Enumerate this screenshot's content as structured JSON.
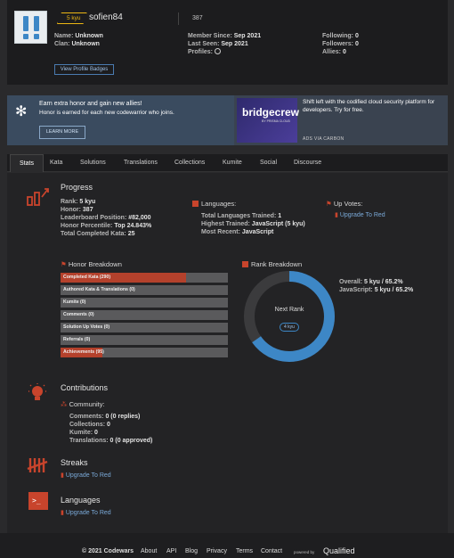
{
  "profile": {
    "rank_badge": "5 kyu",
    "username": "sofien84",
    "honor_score": "387",
    "col1": [
      {
        "label": "Name:",
        "value": "Unknown"
      },
      {
        "label": "Clan:",
        "value": "Unknown"
      }
    ],
    "col2": [
      {
        "label": "Member Since:",
        "value": "Sep 2021"
      },
      {
        "label": "Last Seen:",
        "value": "Sep 2021"
      },
      {
        "label": "Profiles:",
        "value": ""
      }
    ],
    "col3": [
      {
        "label": "Following:",
        "value": "0"
      },
      {
        "label": "Followers:",
        "value": "0"
      },
      {
        "label": "Allies:",
        "value": "0"
      }
    ],
    "badges_button": "View Profile Badges"
  },
  "ad": {
    "headline": "Earn extra honor and gain new allies!",
    "text": "Honor is earned for each new codewarrior who joins.",
    "button": "LEARN MORE",
    "brand": "bridgecrew",
    "brand_sub": "BY PRISMA CLOUD",
    "sponsor_text": "Shift left with the codified cloud security platform for developers. Try for free.",
    "via": "ADS VIA CARBON"
  },
  "tabs": [
    "Stats",
    "Kata",
    "Solutions",
    "Translations",
    "Collections",
    "Kumite",
    "Social",
    "Discourse"
  ],
  "progress": {
    "title": "Progress",
    "rows": [
      {
        "label": "Rank:",
        "value": "5 kyu"
      },
      {
        "label": "Honor:",
        "value": "387"
      },
      {
        "label": "Leaderboard Position:",
        "value": "#82,000"
      },
      {
        "label": "Honor Percentile:",
        "value": "Top 24.843%"
      },
      {
        "label": "Total Completed Kata:",
        "value": "25"
      }
    ]
  },
  "languages_box": {
    "title": "Languages:",
    "rows": [
      {
        "label": "Total Languages Trained:",
        "value": "1"
      },
      {
        "label": "Highest Trained:",
        "value": "JavaScript (5 kyu)"
      },
      {
        "label": "Most Recent:",
        "value": "JavaScript"
      }
    ]
  },
  "upvotes": {
    "title": "Up Votes:",
    "link": "Upgrade To Red"
  },
  "honor_breakdown": {
    "title": "Honor Breakdown",
    "bars": [
      {
        "label": "Completed Kata (290)",
        "fill": 0.75
      },
      {
        "label": "Authored Kata & Translations (0)",
        "fill": 0
      },
      {
        "label": "Kumite (0)",
        "fill": 0
      },
      {
        "label": "Comments (0)",
        "fill": 0
      },
      {
        "label": "Solution Up Votes (0)",
        "fill": 0
      },
      {
        "label": "Referrals (0)",
        "fill": 0
      },
      {
        "label": "Achievements (95)",
        "fill": 0.25
      }
    ]
  },
  "rank_breakdown": {
    "title": "Rank Breakdown",
    "center_label": "Next Rank",
    "next_badge": "4 kyu",
    "progress": 0.652,
    "accent": "#3d87c6",
    "rows": [
      {
        "label": "Overall:",
        "value": "5 kyu / 65.2%"
      },
      {
        "label": "JavaScript:",
        "value": "5 kyu / 65.2%"
      }
    ]
  },
  "contributions": {
    "title": "Contributions",
    "community": "Community:",
    "rows": [
      {
        "label": "Comments:",
        "value": "0 (0 replies)"
      },
      {
        "label": "Collections:",
        "value": "0"
      },
      {
        "label": "Kumite:",
        "value": "0"
      },
      {
        "label": "Translations:",
        "value": "0 (0 approved)"
      }
    ]
  },
  "streaks": {
    "title": "Streaks",
    "link": "Upgrade To Red"
  },
  "languages": {
    "title": "Languages",
    "link": "Upgrade To Red"
  },
  "footer": {
    "copyright": "© 2021 Codewars",
    "links": [
      "About",
      "API",
      "Blog",
      "Privacy",
      "Terms",
      "Contact"
    ],
    "powered": "powered by",
    "brand": "Qualified"
  }
}
